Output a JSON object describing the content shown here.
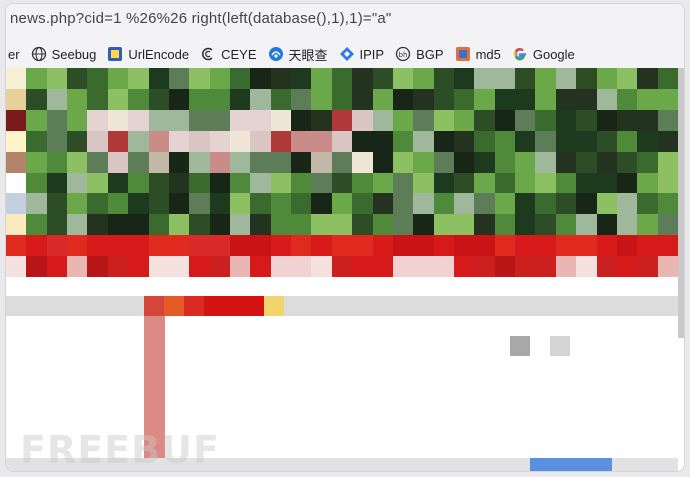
{
  "urlbar": {
    "url": "news.php?cid=1 %26%26 right(left(database(),1),1)=\"a\""
  },
  "bookmarks": [
    {
      "label": "er",
      "icon": "none"
    },
    {
      "label": "Seebug",
      "icon": "globe-icon"
    },
    {
      "label": "UrlEncode",
      "icon": "urlencode-icon"
    },
    {
      "label": "CEYE",
      "icon": "ceye-icon"
    },
    {
      "label": "天眼查",
      "icon": "tianyancha-icon"
    },
    {
      "label": "IPIP",
      "icon": "ipip-icon"
    },
    {
      "label": "BGP",
      "icon": "bgp-icon"
    },
    {
      "label": "md5",
      "icon": "md5-icon"
    },
    {
      "label": "Google",
      "icon": "google-icon"
    }
  ],
  "watermark": "FREEBUF",
  "colors": {
    "urlbar_bg": "#f3f3f5",
    "accent_red": "#d61a1a",
    "scroll_blue": "#5b8fe0"
  }
}
